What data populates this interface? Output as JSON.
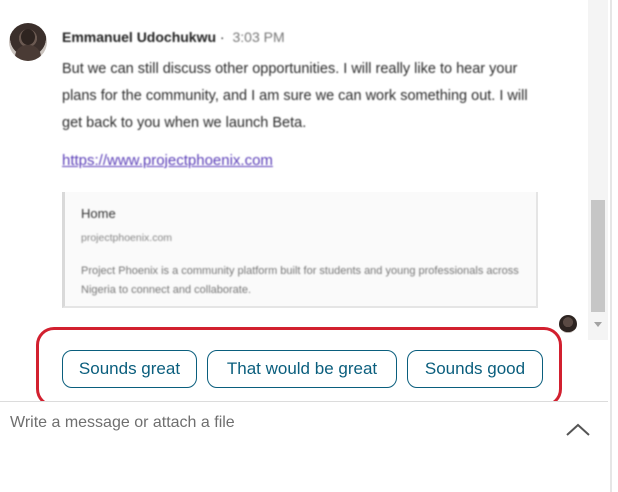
{
  "message": {
    "sender_name": "Emmanuel Udochukwu",
    "separator": " · ",
    "time": "3:03 PM",
    "body": "But we can still discuss other opportunities. I will really like to hear your plans for the community, and I am sure we can work something out. I will get back to you when we launch Beta.",
    "link": "https://www.projectphoenix.com",
    "preview": {
      "title": "Home",
      "domain": "projectphoenix.com",
      "description": "Project Phoenix is a community platform built for students and young professionals across Nigeria to connect and collaborate."
    }
  },
  "quick_replies": [
    "Sounds great",
    "That would be great",
    "Sounds good"
  ],
  "composer": {
    "placeholder": "Write a message or attach a file"
  },
  "colors": {
    "reply_accent": "#0a5e7d",
    "highlight": "#d2202f",
    "link": "#5b3fb8"
  },
  "icons": {
    "expand": "chevron-up-icon",
    "scroll_down": "triangle-down-icon"
  }
}
